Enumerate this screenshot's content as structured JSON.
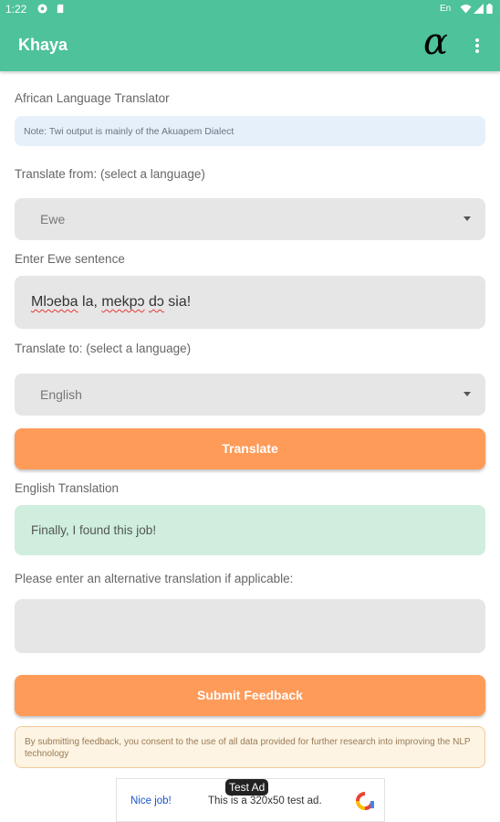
{
  "status_bar": {
    "time": "1:22",
    "lang": "En"
  },
  "app_bar": {
    "title": "Khaya",
    "logo": "α"
  },
  "main": {
    "page_label": "African Language Translator",
    "note": "Note: Twi output is mainly of the Akuapem Dialect",
    "from_label": "Translate from: (select a language)",
    "from_value": "Ewe",
    "input_label": "Enter Ewe sentence",
    "input_value_parts": [
      "Mlɔeba",
      " la, ",
      "mekpɔ",
      " ",
      "dɔ",
      " sia!"
    ],
    "to_label": "Translate to: (select a language)",
    "to_value": "English",
    "translate_button": "Translate",
    "result_label": "English Translation",
    "result_value": "Finally, I found this job!",
    "alt_label": "Please enter an alternative translation if applicable:",
    "alt_value": "",
    "submit_button": "Submit Feedback",
    "consent": "By submitting feedback, you consent to the use of all data provided for further research into improving the NLP technology"
  },
  "ad": {
    "tag": "Test Ad",
    "nice": "Nice job!",
    "desc": "This is a 320x50 test ad."
  },
  "colors": {
    "primary": "#4ec29a",
    "accent": "#ff9b59",
    "result_bg": "#cfeedd",
    "note_bg": "#e6f0fb",
    "consent_bg": "#fdf4e3"
  },
  "icons": [
    "settings-icon",
    "shield-icon",
    "sd-card-icon",
    "wifi-icon",
    "signal-icon",
    "battery-icon",
    "overflow-menu-icon",
    "dropdown-caret-icon",
    "ad-logo-icon"
  ]
}
